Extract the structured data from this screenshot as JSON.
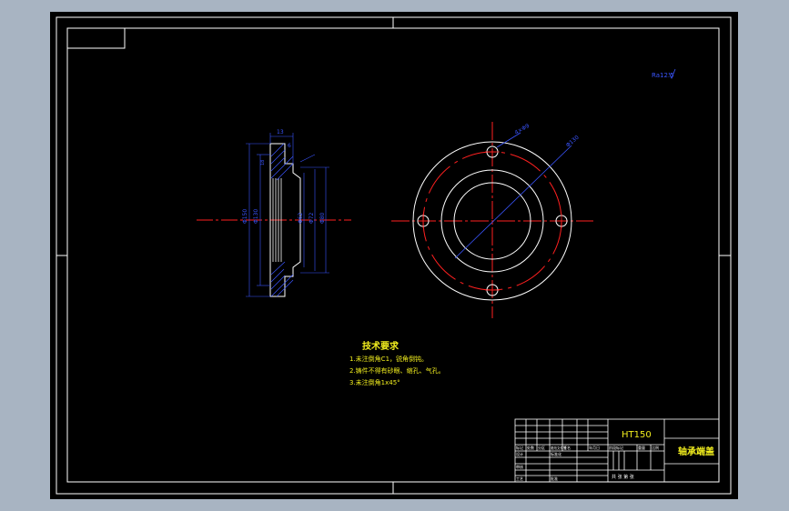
{
  "drawing": {
    "part_name": "轴承端盖",
    "material": "HT150",
    "roughness_note": "Ra12.5",
    "technical_requirements": {
      "title": "技术要求",
      "items": [
        "1.未注倒角C1，锐角倒钝。",
        "2.铸件不得有砂眼、缩孔、气孔。",
        "3.未注倒角1x45°"
      ]
    },
    "dimensions": {
      "hole_callout": "4×Φ9",
      "pcd_callout": "Φ130",
      "thickness": "13",
      "flange_thickness": "6",
      "left_dia_1": "Φ150",
      "left_dia_2": "Φ130",
      "right_dia_1": "Φ80",
      "right_dia_2": "Φ72",
      "right_dia_3": "Φ62",
      "depth": "18"
    },
    "title_block": {
      "marks": "标记",
      "count": "处数",
      "zone": "分区",
      "change_doc": "更改文件号",
      "signature": "签名",
      "date": "年月日",
      "designer": "设计",
      "standardization": "标准化",
      "stage_mark": "阶段标记",
      "weight": "重量",
      "scale": "比例",
      "review": "审核",
      "process": "工艺",
      "approve": "批准",
      "sheets": "共 张 第 张"
    }
  },
  "colors": {
    "background": "#a8b4c2",
    "paper": "#000000",
    "frame": "#ffffff",
    "centerline": "#ff2020",
    "dimension": "#3a55ff",
    "note": "#f2ee1e"
  }
}
